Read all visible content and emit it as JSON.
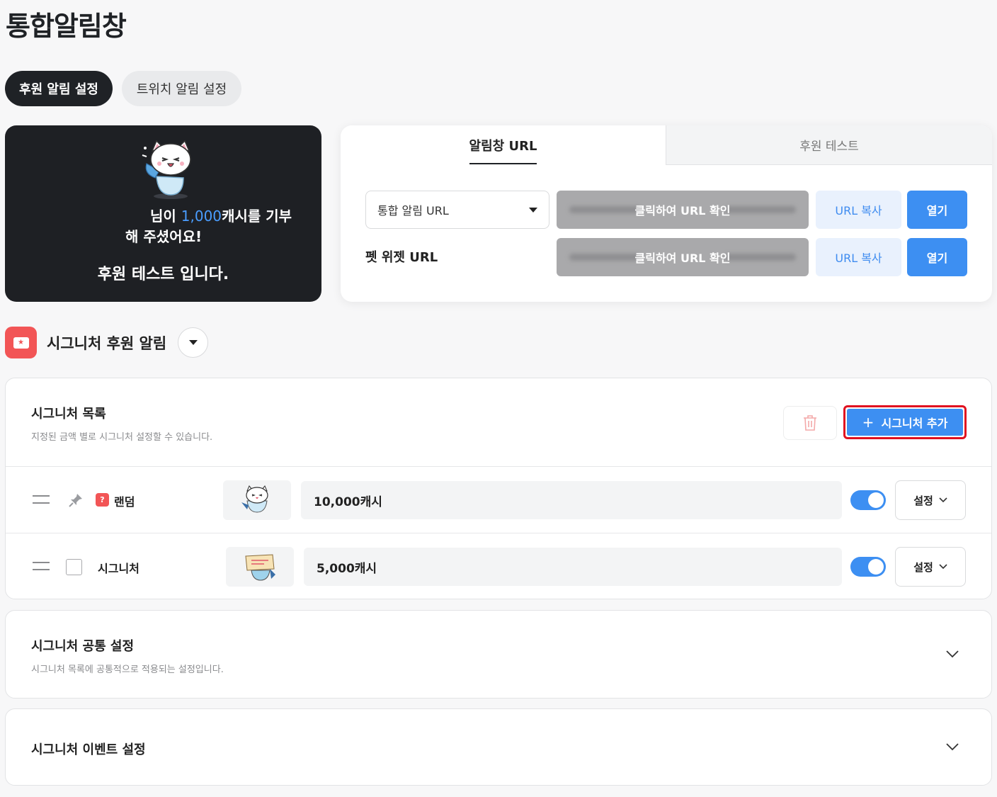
{
  "page": {
    "title": "통합알림창"
  },
  "tabs": {
    "donation_settings": "후원 알림 설정",
    "twitch_settings": "트위치 알림 설정"
  },
  "preview": {
    "line1_suffix_prefix": "님이 ",
    "amount": "1,000",
    "line1_suffix": "캐시를 기부",
    "line2": "해 주셨어요!",
    "message": "후원 테스트 입니다.",
    "mascot_icon": "cat-mascot-icon"
  },
  "url_card": {
    "tab_alert_url": "알림창 URL",
    "tab_donation_test": "후원 테스트",
    "select": {
      "value": "통합 알림 URL"
    },
    "pet_widget_label": "펫 위젯 URL",
    "reveal_label": "클릭하여 URL 확인",
    "copy_label": "URL 복사",
    "open_label": "열기"
  },
  "signature_section": {
    "title": "시그니처 후원 알림"
  },
  "signature_list": {
    "title": "시그니처 목록",
    "description": "지정된 금액 별로 시그니처 설정할 수 있습니다.",
    "add_label": "시그니처 추가",
    "rows": [
      {
        "label": "랜덤",
        "badge": "?",
        "amount": "10,000캐시",
        "enabled": true,
        "setting_label": "설정"
      },
      {
        "label": "시그니처",
        "amount": "5,000캐시",
        "enabled": true,
        "setting_label": "설정"
      }
    ]
  },
  "common_settings": {
    "title": "시그니처 공통 설정",
    "description": "시그니처 목록에 공통적으로 적용되는 설정입니다."
  },
  "event_settings": {
    "title": "시그니처 이벤트 설정"
  },
  "colors": {
    "accent": "#3d8ff2",
    "brand_red": "#f25556",
    "dark": "#1e2024",
    "highlight_border": "#e01020"
  }
}
